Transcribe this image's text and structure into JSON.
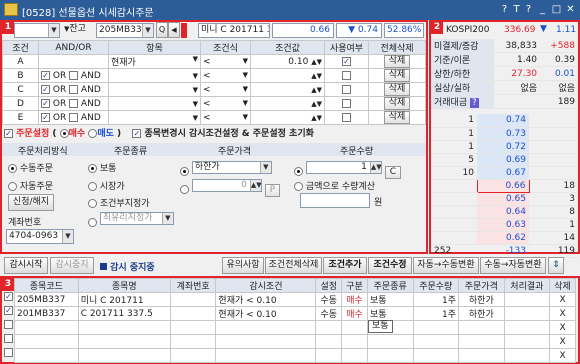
{
  "window": {
    "title": "[0528] 선물옵션 시세감시주문",
    "controls": [
      "?",
      "T",
      "?",
      "_",
      "□",
      "X"
    ]
  },
  "toolbar": {
    "jango_label": "잔고",
    "code": "205MB337",
    "product": "미니 C 201711 337.",
    "price": "0.66",
    "change": "0.74",
    "pct": "52.86%"
  },
  "conditions": {
    "headers": [
      "조건",
      "AND/OR",
      "항목",
      "조건식",
      "조건값",
      "사용여부",
      "전체삭제"
    ],
    "rows": [
      {
        "id": "A",
        "logic": "",
        "item": "현재가",
        "op": "<",
        "value": "0.10",
        "use": true,
        "del": "삭제",
        "or": false,
        "and": false
      },
      {
        "id": "B",
        "logic": "OR AND",
        "item": "",
        "op": "<",
        "value": "",
        "use": false,
        "del": "삭제",
        "or": true,
        "and": false
      },
      {
        "id": "C",
        "logic": "OR AND",
        "item": "",
        "op": "<",
        "value": "",
        "use": false,
        "del": "삭제",
        "or": true,
        "and": false
      },
      {
        "id": "D",
        "logic": "OR AND",
        "item": "",
        "op": "<",
        "value": "",
        "use": false,
        "del": "삭제",
        "or": true,
        "and": false
      },
      {
        "id": "E",
        "logic": "OR AND",
        "item": "",
        "op": "<",
        "value": "",
        "use": false,
        "del": "삭제",
        "or": true,
        "and": false
      }
    ]
  },
  "order_setting": {
    "label": "주문설정",
    "buy": "매수",
    "sell": "매도",
    "chk2": "종목변경시 감시조건설정 & 주문설정 초기화",
    "method_title": "주문처리방식",
    "method_auto_manual": [
      "수동주문",
      "자동주문"
    ],
    "method_btn": "신청/해지",
    "account_label": "계좌번호",
    "account": "4704-0963",
    "type_title": "주문종류",
    "types": [
      "보통",
      "시장가",
      "조건부지정가"
    ],
    "type_select": "최유리지정가",
    "price_title": "주문가격",
    "price_select": "하한가",
    "price_value": "0",
    "qty_title": "주문수량",
    "qty_value": "1",
    "qty_btn": "C",
    "qty_alt": "금액으로 수량계산",
    "won": "원"
  },
  "quote": {
    "symbol": "KOSPI200",
    "symval": "336.69",
    "symchg": "1.11",
    "stats": [
      {
        "k": "미결제/증감",
        "v1": "38,833",
        "v2": "+588"
      },
      {
        "k": "기준/이론",
        "v1": "1.40",
        "v2": "0.39"
      },
      {
        "k": "상한/하한",
        "v1": "27.30",
        "v2": "0.01"
      },
      {
        "k": "실상/실하",
        "v1": "없음",
        "v2": "없음"
      },
      {
        "k": "거래대금",
        "v1": "",
        "v2": "189"
      }
    ],
    "asks": [
      {
        "q": "1",
        "p": "0.74"
      },
      {
        "q": "1",
        "p": "0.73"
      },
      {
        "q": "1",
        "p": "0.72"
      },
      {
        "q": "5",
        "p": "0.69"
      },
      {
        "q": "10",
        "p": "0.67"
      }
    ],
    "bids": [
      {
        "p": "0.66",
        "q": "18"
      },
      {
        "p": "0.65",
        "q": "3"
      },
      {
        "p": "0.64",
        "q": "8"
      },
      {
        "p": "0.63",
        "q": "1"
      },
      {
        "p": "0.62",
        "q": "14"
      }
    ],
    "total_ask": "252",
    "total_diff": "-133",
    "total_bid": "119"
  },
  "actions": {
    "start": "감시시작",
    "stop": "감시중지",
    "status": "감시 중지중",
    "left": [
      "유의사항",
      "조건전체삭제",
      "조건추가",
      "조건수정",
      "자동→수동변환",
      "수동→자동변환"
    ]
  },
  "orders": {
    "headers": [
      "종목코드",
      "종목명",
      "계좌번호",
      "감시조건",
      "설정",
      "구분",
      "주문종류",
      "주문수량",
      "주문가격",
      "처리결과",
      "삭제"
    ],
    "rows": [
      {
        "code": "205MB337",
        "name": "미니 C 201711",
        "acct": "",
        "cond": "현재가 < 0.10",
        "set": "수동",
        "side": "매수",
        "type": "보통",
        "qty": "1주",
        "price": "하한가",
        "result": "",
        "del": "X"
      },
      {
        "code": "201MB337",
        "name": "C 201711 337.5",
        "acct": "",
        "cond": "현재가 < 0.10",
        "set": "수동",
        "side": "매수",
        "type": "보통",
        "qty": "1주",
        "price": "하한가",
        "result": "",
        "del": "X"
      }
    ],
    "tooltip": "보통"
  }
}
